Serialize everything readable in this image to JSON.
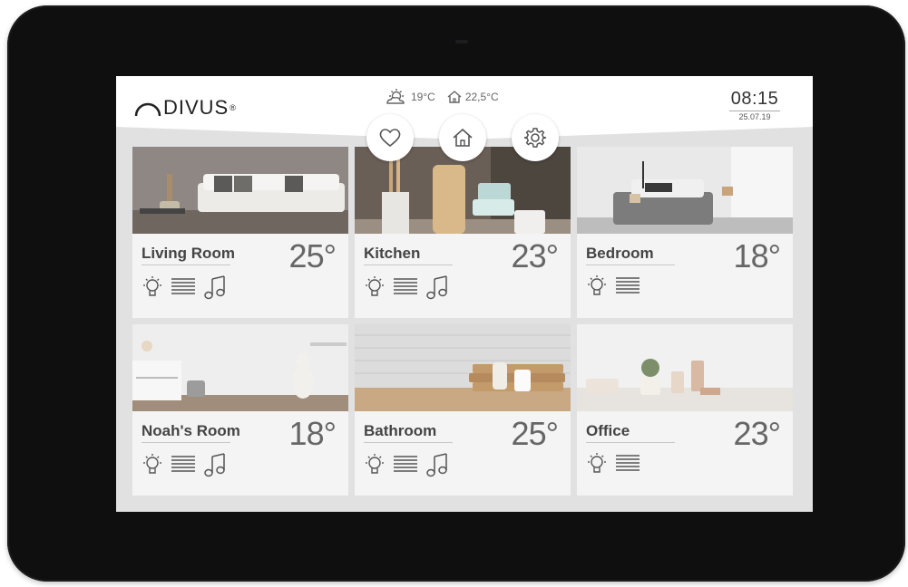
{
  "brand": {
    "name": "DIVUS",
    "mark": "®"
  },
  "status": {
    "outdoor_temp": "19°C",
    "indoor_temp": "22,5°C",
    "time": "08:15",
    "date": "25.07.19"
  },
  "nav": [
    {
      "id": "favorites",
      "icon": "heart-icon"
    },
    {
      "id": "home",
      "icon": "home-icon"
    },
    {
      "id": "settings",
      "icon": "gear-icon"
    }
  ],
  "rooms": [
    {
      "name": "Living Room",
      "temp": "25°",
      "controls": [
        "light",
        "blinds",
        "music"
      ]
    },
    {
      "name": "Kitchen",
      "temp": "23°",
      "controls": [
        "light",
        "blinds",
        "music"
      ]
    },
    {
      "name": "Bedroom",
      "temp": "18°",
      "controls": [
        "light",
        "blinds"
      ]
    },
    {
      "name": "Noah's Room",
      "temp": "18°",
      "controls": [
        "light",
        "blinds",
        "music"
      ]
    },
    {
      "name": "Bathroom",
      "temp": "25°",
      "controls": [
        "light",
        "blinds",
        "music"
      ]
    },
    {
      "name": "Office",
      "temp": "23°",
      "controls": [
        "light",
        "blinds"
      ]
    }
  ],
  "colors": {
    "frame": "#0f0f10",
    "screen_bg": "#e1e1e1",
    "card_bg": "#f4f4f4",
    "icon": "#555555"
  }
}
